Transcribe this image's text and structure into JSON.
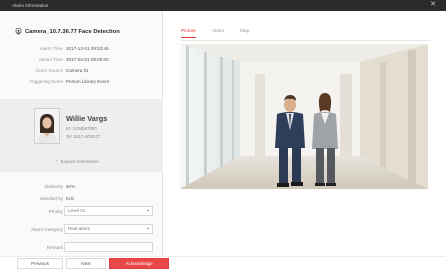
{
  "window": {
    "title": "Alarm Information",
    "close_glyph": "✕"
  },
  "camera": {
    "icon": "camera-icon",
    "title": "Camera_10.7.36.77 Face Detection"
  },
  "details": [
    {
      "label": "Alarm Time",
      "value": "2017-12-01 09:53:45"
    },
    {
      "label": "Saved Time",
      "value": "2017-04-01 09:00:00"
    },
    {
      "label": "Alarm Source",
      "value": "Camera 01"
    },
    {
      "label": "Triggering Event",
      "value": "Person Library Event"
    }
  ],
  "person": {
    "name": "Willie Vargs",
    "id_line": "ID: 1234567890",
    "tel_line": "Tel: 2017-4/00127",
    "expand_label": "Expand Information"
  },
  "metrics": [
    {
      "label": "Similarity",
      "value": "80%"
    },
    {
      "label": "Handled by",
      "value": "Edit"
    }
  ],
  "form": {
    "priority_label": "Priority",
    "priority_value": "Level 01",
    "category_label": "Alarm Category",
    "category_value": "Real alarm",
    "remark_label": "Remark"
  },
  "tabs": {
    "items": [
      "Picture",
      "Video",
      "Map"
    ],
    "active": "Picture"
  },
  "buttons": {
    "previous": "Previous",
    "next": "Next",
    "acknowledge": "Acknowledge"
  },
  "colors": {
    "accent": "#e03c3c",
    "titlebar": "#2b2b2b"
  }
}
